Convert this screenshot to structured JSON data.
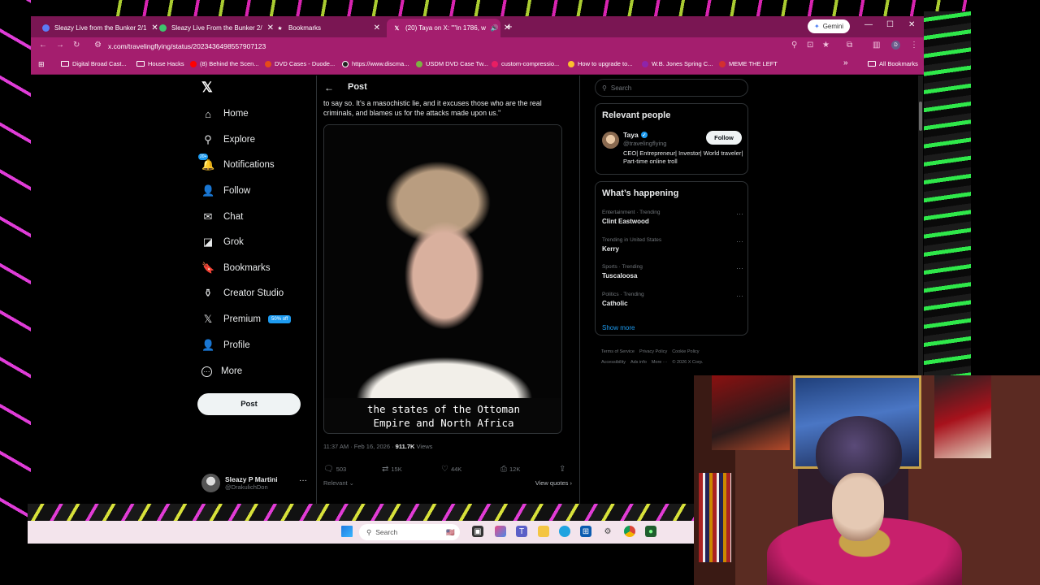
{
  "browser": {
    "tabs": [
      {
        "label": "Sleazy Live from the Bunker 2/1",
        "favicon_color": "#5b7cf6",
        "active": false
      },
      {
        "label": "Sleazy Live From the Bunker 2/",
        "favicon_color": "#3ec46d",
        "active": false
      },
      {
        "label": "Bookmarks",
        "favicon_color": "#ffffff",
        "active": false
      },
      {
        "label": "(20) Taya on X: \"\"In 1786, w",
        "favicon_color": "#ffffff",
        "active": true
      }
    ],
    "new_tab": "+",
    "gemini_label": "Gemini",
    "url": "x.com/travelingflying/status/2023436498557907123",
    "bookmarks": [
      {
        "label": "Digital Broad Cast...",
        "kind": "folder"
      },
      {
        "label": "House Hacks",
        "kind": "folder"
      },
      {
        "label": "(8) Behind the Scen...",
        "kind": "dot",
        "color": "#ff0000"
      },
      {
        "label": "DVD Cases - Duode...",
        "kind": "dot",
        "color": "#e64a19"
      },
      {
        "label": "https://www.discma...",
        "kind": "dot",
        "color": "#222222"
      },
      {
        "label": "USDM DVD Case Tw...",
        "kind": "dot",
        "color": "#7cb342"
      },
      {
        "label": "custom-compressio...",
        "kind": "dot",
        "color": "#e91e63"
      },
      {
        "label": "How to upgrade to...",
        "kind": "dot",
        "color": "#fbc02d"
      },
      {
        "label": "W.B. Jones Spring C...",
        "kind": "dot",
        "color": "#8e24aa"
      },
      {
        "label": "MEME THE LEFT",
        "kind": "dot",
        "color": "#d32f2f"
      }
    ],
    "all_bookmarks": "All Bookmarks",
    "overflow": "»"
  },
  "nav": {
    "logo": "𝕏",
    "items": [
      {
        "label": "Home",
        "icon": "⌂",
        "icon_name": "home-icon"
      },
      {
        "label": "Explore",
        "icon": "⚲",
        "icon_name": "search-icon"
      },
      {
        "label": "Notifications",
        "icon": "🔔",
        "icon_name": "bell-icon",
        "badge": "20+"
      },
      {
        "label": "Follow",
        "icon": "👤",
        "icon_name": "person-add-icon"
      },
      {
        "label": "Chat",
        "icon": "✉",
        "icon_name": "envelope-icon"
      },
      {
        "label": "Grok",
        "icon": "◪",
        "icon_name": "grok-icon"
      },
      {
        "label": "Bookmarks",
        "icon": "🔖",
        "icon_name": "bookmark-icon"
      },
      {
        "label": "Creator Studio",
        "icon": "⚱",
        "icon_name": "creator-studio-icon"
      },
      {
        "label": "Premium",
        "icon": "𝕏",
        "icon_name": "premium-icon",
        "promo": "50% off"
      },
      {
        "label": "Profile",
        "icon": "👤",
        "icon_name": "profile-icon"
      },
      {
        "label": "More",
        "icon": "⋯",
        "icon_name": "more-icon"
      }
    ],
    "post_button": "Post",
    "account": {
      "name": "Sleazy P Martini",
      "handle": "@DrakulichDon"
    }
  },
  "post": {
    "header_title": "Post",
    "text": "to say so. It's a masochistic lie, and it excuses those who are the real criminals, and blames us for the attacks made upon us.\"",
    "video_caption_line1": "the states of the Ottoman",
    "video_caption_line2": "Empire and North Africa",
    "timestamp": "11:37 AM · Feb 16, 2026 · ",
    "views_count": "911.7K",
    "views_label": " Views",
    "replies": "503",
    "reposts": "15K",
    "likes": "44K",
    "bookmarks": "12K",
    "sort_label": "Relevant ⌄",
    "view_quotes": "View quotes ›"
  },
  "sidebar": {
    "search_placeholder": "Search",
    "relevant_people": {
      "title": "Relevant people",
      "name": "Taya",
      "handle": "@travelingflying",
      "follow": "Follow",
      "bio": "CEO| Entrepreneur| Investor| World traveler| Part-time online troll"
    },
    "whats_happening": {
      "title": "What’s happening",
      "trends": [
        {
          "category": "Entertainment · Trending",
          "name": "Clint Eastwood"
        },
        {
          "category": "Trending in United States",
          "name": "Kerry"
        },
        {
          "category": "Sports · Trending",
          "name": "Tuscaloosa"
        },
        {
          "category": "Politics · Trending",
          "name": "Catholic"
        }
      ],
      "show_more": "Show more"
    },
    "footer": {
      "terms": "Terms of Service",
      "privacy": "Privacy Policy",
      "cookie": "Cookie Policy",
      "accessibility": "Accessibility",
      "ads": "Ads info",
      "more": "More ···",
      "copyright": "© 2026 X Corp."
    }
  },
  "taskbar": {
    "search_placeholder": "Search"
  }
}
